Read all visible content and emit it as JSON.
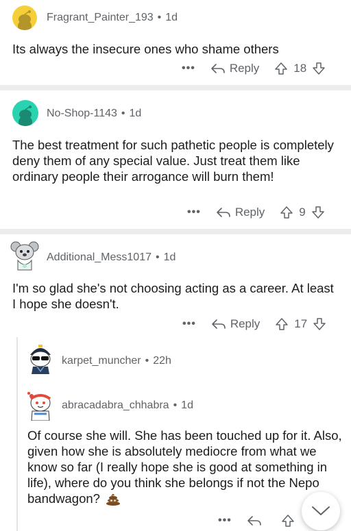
{
  "comments": [
    {
      "username": "Fragrant_Painter_193",
      "age": "1d",
      "text": "Its always the insecure ones who shame others",
      "more": "•••",
      "reply_label": "Reply",
      "votes": "18",
      "avatar_color": "#f5cf3a"
    },
    {
      "username": "No-Shop-1143",
      "age": "1d",
      "text": "The best treatment for such pathetic people is completely deny them of any special value. Just treat them like ordinary people their arrogance will burn them!",
      "more": "•••",
      "reply_label": "Reply",
      "votes": "9",
      "avatar_color": "#2ad3b0"
    },
    {
      "username": "Additional_Mess1017",
      "age": "1d",
      "text": "I'm so glad she's not choosing acting as a career. At least I hope she doesn't.",
      "more": "•••",
      "reply_label": "Reply",
      "votes": "17"
    },
    {
      "username": "karpet_muncher",
      "age": "22h"
    },
    {
      "username": "abracadabra_chhabra",
      "age": "1d",
      "text": "Of course she will. She has been touched up for it. Also, given how she is absolutely mediocre from what we know so far (I really hope she is good at something in life), where do you think she belongs if not the Nepo bandwagon?",
      "more": "•••"
    }
  ],
  "icons": {
    "reply": "reply-arrow-icon",
    "upvote": "upvote-arrow-icon",
    "downvote": "downvote-arrow-icon",
    "scroll_down": "chevron-down-icon",
    "emoji": "poop-emoji-icon"
  },
  "colors": {
    "meta_text": "#5f6368",
    "separator": "#ececec"
  }
}
